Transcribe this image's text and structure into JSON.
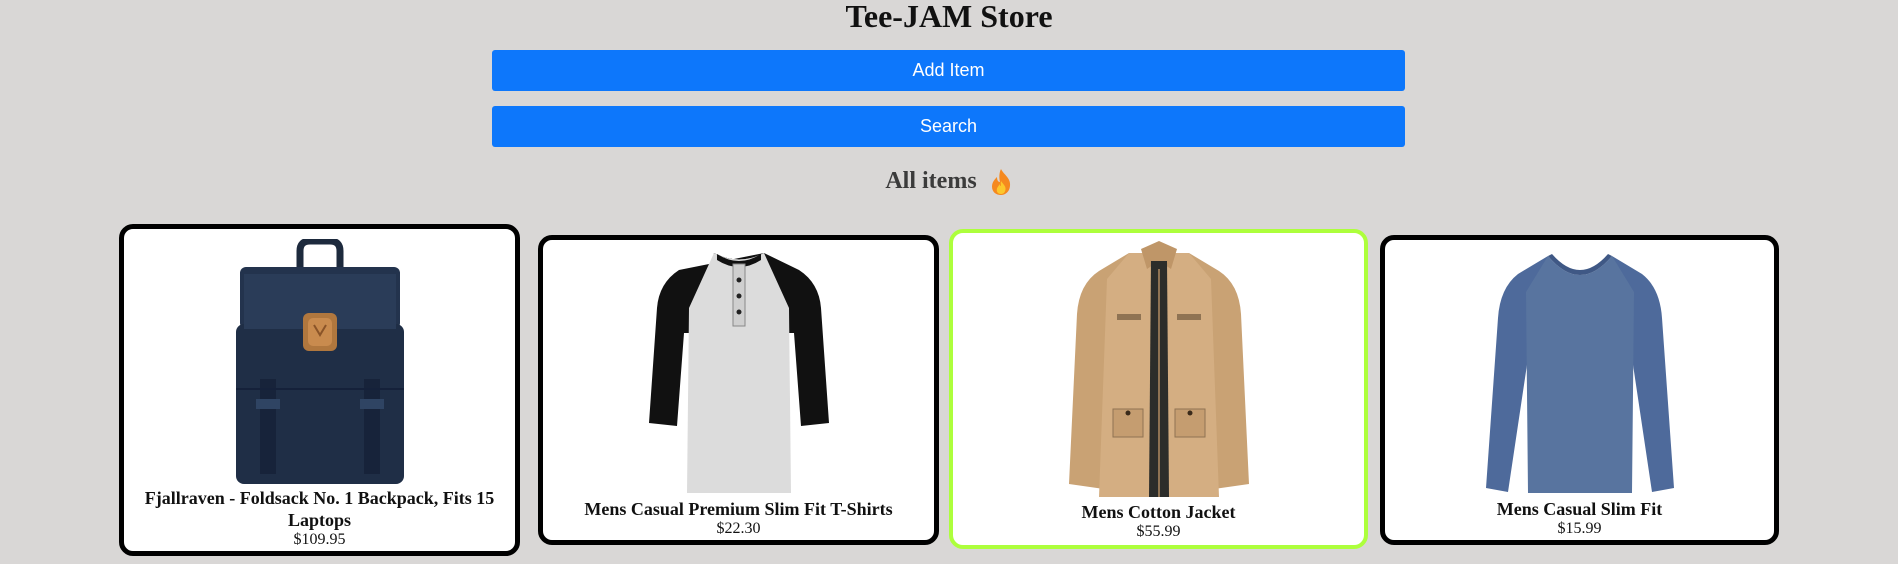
{
  "header": {
    "title": "Tee-JAM Store"
  },
  "actions": {
    "add_label": "Add Item",
    "search_label": "Search"
  },
  "section": {
    "heading": "All items",
    "icon": "fire-icon"
  },
  "colors": {
    "background": "#d9d7d6",
    "button": "#0d77fb",
    "card_border": "#000000",
    "card_highlight_border": "#adff3c"
  },
  "products": [
    {
      "name": "Fjallraven - Foldsack No. 1 Backpack, Fits 15 Laptops",
      "price": "$109.95",
      "image": "navy-backpack"
    },
    {
      "name": "Mens Casual Premium Slim Fit T-Shirts",
      "price": "$22.30",
      "image": "raglan-henley-shirt"
    },
    {
      "name": "Mens Cotton Jacket",
      "price": "$55.99",
      "image": "khaki-jacket"
    },
    {
      "name": "Mens Casual Slim Fit",
      "price": "$15.99",
      "image": "blue-long-sleeve-shirt"
    }
  ]
}
